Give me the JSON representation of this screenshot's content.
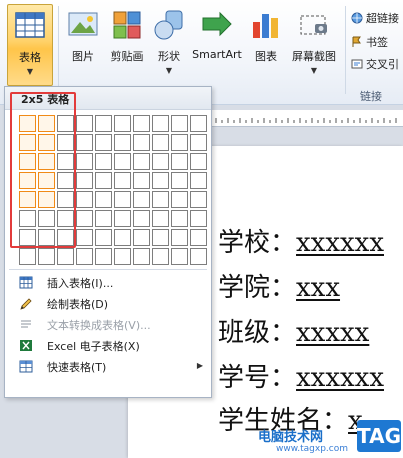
{
  "ribbon": {
    "buttons": [
      {
        "label": "表格",
        "icon": "table-icon"
      },
      {
        "label": "图片",
        "icon": "picture-icon"
      },
      {
        "label": "剪贴画",
        "icon": "clipart-icon"
      },
      {
        "label": "形状",
        "icon": "shapes-icon"
      },
      {
        "label": "SmartArt",
        "icon": "smartart-icon"
      },
      {
        "label": "图表",
        "icon": "chart-icon"
      },
      {
        "label": "屏幕截图",
        "icon": "screenshot-icon"
      }
    ],
    "links": {
      "items": [
        "超链接",
        "书签",
        "交叉引"
      ],
      "group_label": "链接"
    },
    "accent": "#ffc54a"
  },
  "dropdown": {
    "header": "2x5 表格",
    "grid": {
      "columns": 10,
      "rows": 8,
      "selected_columns": 2,
      "selected_rows": 5
    },
    "highlight_color": "#f08a17",
    "annotation_color": "#e23b3b",
    "menu": [
      {
        "label": "插入表格(I)...",
        "icon": "insert-table-icon",
        "disabled": false
      },
      {
        "label": "绘制表格(D)",
        "icon": "draw-table-pencil-icon",
        "disabled": false
      },
      {
        "label": "文本转换成表格(V)...",
        "icon": "text-to-table-icon",
        "disabled": true
      },
      {
        "label": "Excel 电子表格(X)",
        "icon": "excel-icon",
        "disabled": false
      },
      {
        "label": "快速表格(T)",
        "icon": "quick-table-icon",
        "disabled": false,
        "submenu": true
      }
    ]
  },
  "document": {
    "lines": [
      {
        "label": "学校：",
        "value": "xxxxxx"
      },
      {
        "label": "学院：",
        "value": "xxx"
      },
      {
        "label": "班级：",
        "value": "xxxxx"
      },
      {
        "label": "学号：",
        "value": "xxxxxx"
      },
      {
        "label": "学生姓名：",
        "value": "x"
      }
    ]
  },
  "watermark": {
    "site": "电脑技术网",
    "url": "www.tagxp.com",
    "tag": "TAG"
  }
}
